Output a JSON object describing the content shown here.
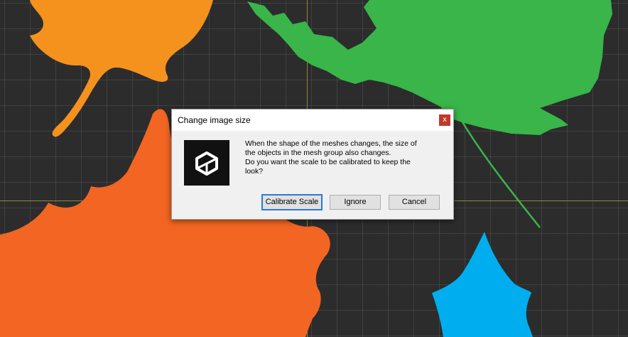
{
  "dialog": {
    "title": "Change image size",
    "close_glyph": "x",
    "message_lines": [
      "When the shape of the meshes changes, the size of",
      "the objects in the mesh group also changes.",
      "Do you want the scale to be calibrated to keep the",
      "look?"
    ],
    "buttons": {
      "calibrate": "Calibrate Scale",
      "ignore": "Ignore",
      "cancel": "Cancel"
    },
    "icon": "unity-logo-icon"
  },
  "colors": {
    "orange_leaf_top": "#f5921e",
    "orange_leaf_bottom": "#f26522",
    "green_leaf": "#39b54a",
    "blue_leaf": "#00aeef",
    "highlight": "#e4162c",
    "canvas": "#2c2c2c"
  }
}
